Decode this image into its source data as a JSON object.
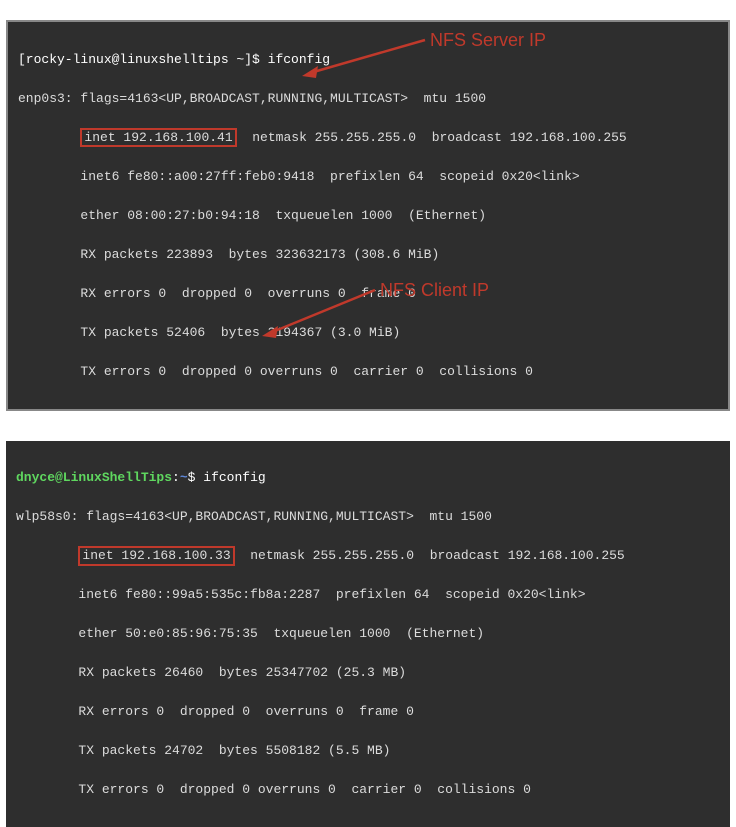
{
  "annotations": {
    "server_label": "NFS Server IP",
    "client_label": "NFS Client IP"
  },
  "server": {
    "prompt": "[rocky-linux@linuxshelltips ~]$ ",
    "command": "ifconfig",
    "interface": "enp0s3: flags=4163<UP,BROADCAST,RUNNING,MULTICAST>  mtu 1500",
    "inet_box": "inet 192.168.100.41",
    "inet_rest": "  netmask 255.255.255.0  broadcast 192.168.100.255",
    "inet6": "        inet6 fe80::a00:27ff:feb0:9418  prefixlen 64  scopeid 0x20<link>",
    "ether": "        ether 08:00:27:b0:94:18  txqueuelen 1000  (Ethernet)",
    "rx_packets": "        RX packets 223893  bytes 323632173 (308.6 MiB)",
    "rx_errors": "        RX errors 0  dropped 0  overruns 0  frame 0",
    "tx_packets": "        TX packets 52406  bytes 3194367 (3.0 MiB)",
    "tx_errors": "        TX errors 0  dropped 0 overruns 0  carrier 0  collisions 0"
  },
  "client": {
    "prompt_user": "dnyce@LinuxShellTips",
    "prompt_sep": ":",
    "prompt_path": "~",
    "prompt_end": "$ ",
    "command": "ifconfig",
    "interface": "wlp58s0: flags=4163<UP,BROADCAST,RUNNING,MULTICAST>  mtu 1500",
    "inet_box": "inet 192.168.100.33",
    "inet_rest": "  netmask 255.255.255.0  broadcast 192.168.100.255",
    "inet6": "        inet6 fe80::99a5:535c:fb8a:2287  prefixlen 64  scopeid 0x20<link>",
    "ether": "        ether 50:e0:85:96:75:35  txqueuelen 1000  (Ethernet)",
    "rx_packets": "        RX packets 26460  bytes 25347702 (25.3 MB)",
    "rx_errors": "        RX errors 0  dropped 0  overruns 0  frame 0",
    "tx_packets": "        TX packets 24702  bytes 5508182 (5.5 MB)",
    "tx_errors": "        TX errors 0  dropped 0 overruns 0  carrier 0  collisions 0"
  }
}
